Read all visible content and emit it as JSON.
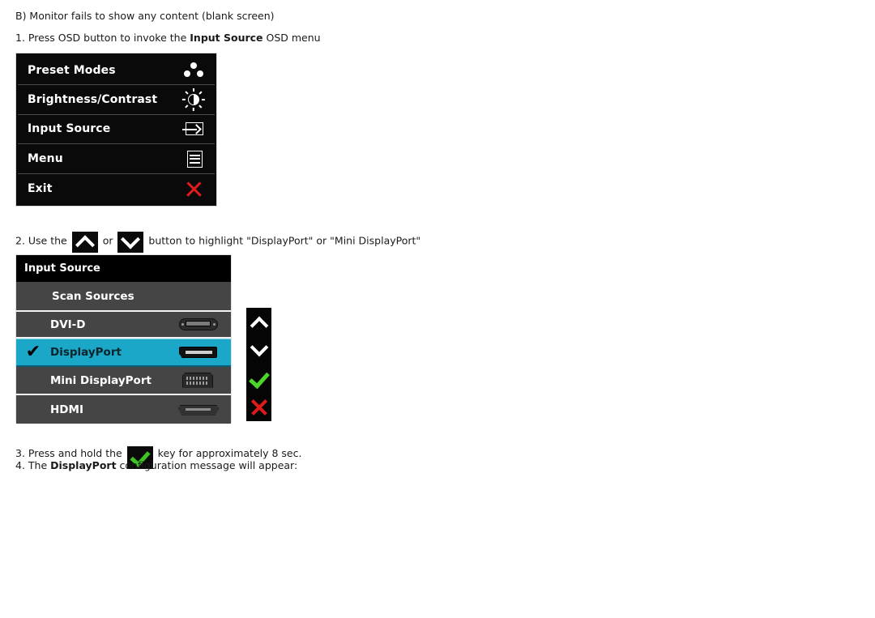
{
  "document": {
    "heading": "B) Monitor fails to show any content (blank screen)",
    "step1": {
      "prefix": "1. Press OSD button to invoke the ",
      "bold": "Input Source",
      "suffix": " OSD menu"
    },
    "step2": {
      "prefix": "2. Use the ",
      "mid": " or ",
      "suffix": " button to highlight \"DisplayPort\" or \"Mini DisplayPort\"",
      "up_key_icon": "chevron-up-icon",
      "down_key_icon": "chevron-down-icon"
    },
    "step3": {
      "prefix": "3. Press and hold the ",
      "suffix": " key for approximately 8 sec.",
      "key_icon": "checkmark-icon"
    },
    "step4": {
      "prefix": "4. The ",
      "bold": "DisplayPort",
      "suffix": " configuration message will appear:"
    }
  },
  "osd_main_menu": {
    "rows": [
      {
        "label": "Preset Modes",
        "icon": "preset-modes-icon"
      },
      {
        "label": "Brightness/Contrast",
        "icon": "brightness-contrast-icon"
      },
      {
        "label": "Input Source",
        "icon": "input-source-icon"
      },
      {
        "label": "Menu",
        "icon": "menu-icon"
      },
      {
        "label": "Exit",
        "icon": "exit-x-icon"
      }
    ]
  },
  "osd_input_source": {
    "title": "Input Source",
    "rows": [
      {
        "label": "Scan Sources",
        "connector": "",
        "selected": false,
        "check": ""
      },
      {
        "label": "DVI-D",
        "connector": "dvi-d-connector-icon",
        "selected": false,
        "check": ""
      },
      {
        "label": "DisplayPort",
        "connector": "displayport-connector-icon",
        "selected": true,
        "check": "✔"
      },
      {
        "label": "Mini DisplayPort",
        "connector": "mini-displayport-connector-icon",
        "selected": false,
        "check": ""
      },
      {
        "label": "HDMI",
        "connector": "hdmi-connector-icon",
        "selected": false,
        "check": ""
      }
    ]
  },
  "button_strip": {
    "buttons": [
      {
        "name": "up-button",
        "icon": "chevron-up-icon"
      },
      {
        "name": "down-button",
        "icon": "chevron-down-icon"
      },
      {
        "name": "confirm-button",
        "icon": "checkmark-icon"
      },
      {
        "name": "exit-button",
        "icon": "close-x-icon"
      }
    ]
  },
  "colors": {
    "highlight": "#1aa7c8",
    "panel_dark": "#0a0a0a",
    "panel_gray": "#454545",
    "accent_red": "#e11a1a",
    "accent_green": "#4dd62a"
  }
}
